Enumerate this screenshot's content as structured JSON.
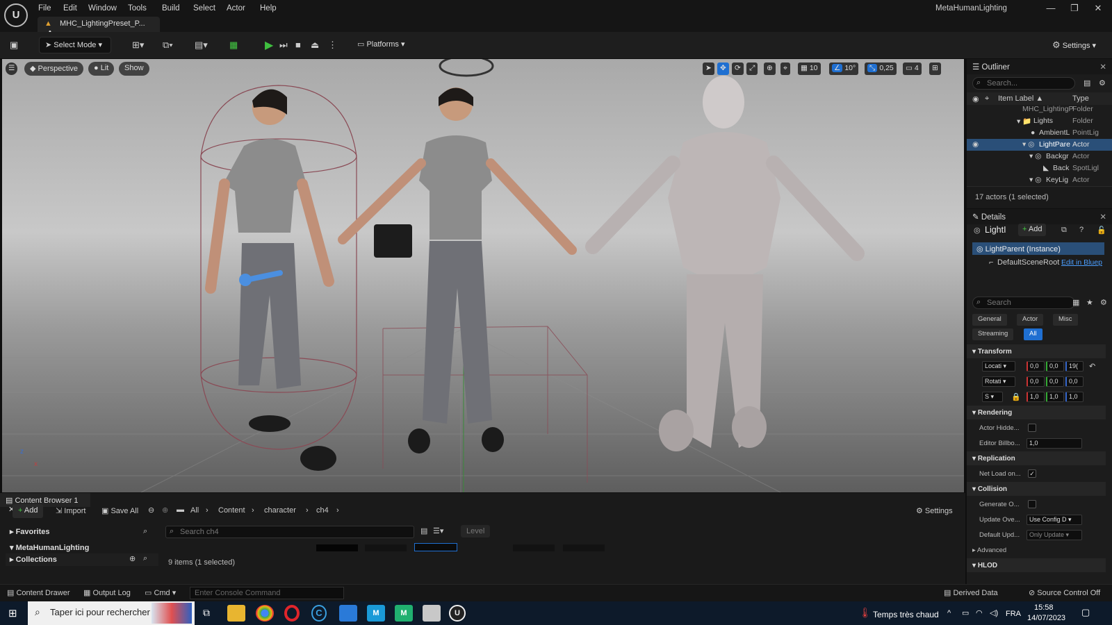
{
  "app": {
    "menu": [
      "File",
      "Edit",
      "Window",
      "Tools",
      "Build",
      "Select",
      "Actor",
      "Help"
    ],
    "project_name": "MetaHumanLighting",
    "doc_tab": "MHC_LightingPreset_P...",
    "doc_tab_dirty": "•",
    "window_controls": {
      "minimize": "—",
      "maximize": "❐",
      "close": "✕"
    }
  },
  "toolbar": {
    "select_mode": "Select Mode",
    "platforms": "Platforms",
    "settings": "Settings"
  },
  "viewport": {
    "perspective": "Perspective",
    "lit": "Lit",
    "show": "Show",
    "grid_size": "10",
    "rotation_snap": "10°",
    "scale_snap": "0,25",
    "camera_speed": "4",
    "axis_z": "z",
    "axis_x": "x"
  },
  "outliner": {
    "title": "Outliner",
    "search_placeholder": "Search...",
    "col_label": "Item Label ▲",
    "col_type": "Type",
    "rows": [
      {
        "label": "MHC_LightingP",
        "type": "Folder"
      },
      {
        "label": "Lights",
        "type": "Folder"
      },
      {
        "label": "AmbientL",
        "type": "PointLig"
      },
      {
        "label": "LightPare",
        "type": "Actor"
      },
      {
        "label": "Backgr",
        "type": "Actor"
      },
      {
        "label": "Back",
        "type": "SpotLigl"
      },
      {
        "label": "KeyLig",
        "type": "Actor"
      }
    ],
    "summary": "17 actors (1 selected)"
  },
  "details": {
    "title": "Details",
    "actor_name": "LightI",
    "add_label": "Add",
    "instance_label": "LightParent (Instance)",
    "root_component": "DefaultSceneRoot",
    "edit_link": "Edit in Bluep",
    "search_placeholder": "Search",
    "filters": [
      "General",
      "Actor",
      "Misc",
      "Streaming",
      "All"
    ],
    "transform": {
      "section": "Transform",
      "location_label": "Locati",
      "rotation_label": "Rotati",
      "scale_label": "S",
      "location": [
        "0,0",
        "0,0",
        "19("
      ],
      "rotation": [
        "0,0",
        "0,0",
        "0,0"
      ],
      "scale": [
        "1,0",
        "1,0",
        "1,0"
      ]
    },
    "rendering": {
      "section": "Rendering",
      "actor_hidden": "Actor Hidde...",
      "editor_billboard": "Editor Billbo...",
      "billboard_value": "1,0"
    },
    "replication": {
      "section": "Replication",
      "net_load": "Net Load on..."
    },
    "collision": {
      "section": "Collision",
      "generate": "Generate O...",
      "update_overlaps": "Update Ove...",
      "update_value": "Use Config D",
      "default_update": "Default Upd...",
      "default_value": "Only Update"
    },
    "advanced": "Advanced",
    "hlod": "HLOD"
  },
  "content_browser": {
    "title": "Content Browser 1",
    "add": "Add",
    "import": "Import",
    "save_all": "Save All",
    "breadcrumbs": [
      "All",
      "Content",
      "character",
      "ch4"
    ],
    "settings": "Settings",
    "favorites": "Favorites",
    "project_folder": "MetaHumanLighting",
    "collections": "Collections",
    "search_placeholder": "Search ch4",
    "filter_chip": "Level",
    "item_count": "9 items (1 selected)"
  },
  "statusbar": {
    "content_drawer": "Content Drawer",
    "output_log": "Output Log",
    "cmd": "Cmd",
    "console_placeholder": "Enter Console Command",
    "derived_data": "Derived Data",
    "source_control": "Source Control Off"
  },
  "taskbar": {
    "search_placeholder": "Taper ici pour rechercher",
    "weather": "Temps très chaud",
    "lang": "FRA",
    "time": "15:58",
    "date": "14/07/2023"
  },
  "colors": {
    "accent": "#1f6fd1",
    "play": "#3fbf3f",
    "selection": "#2a4f78"
  }
}
